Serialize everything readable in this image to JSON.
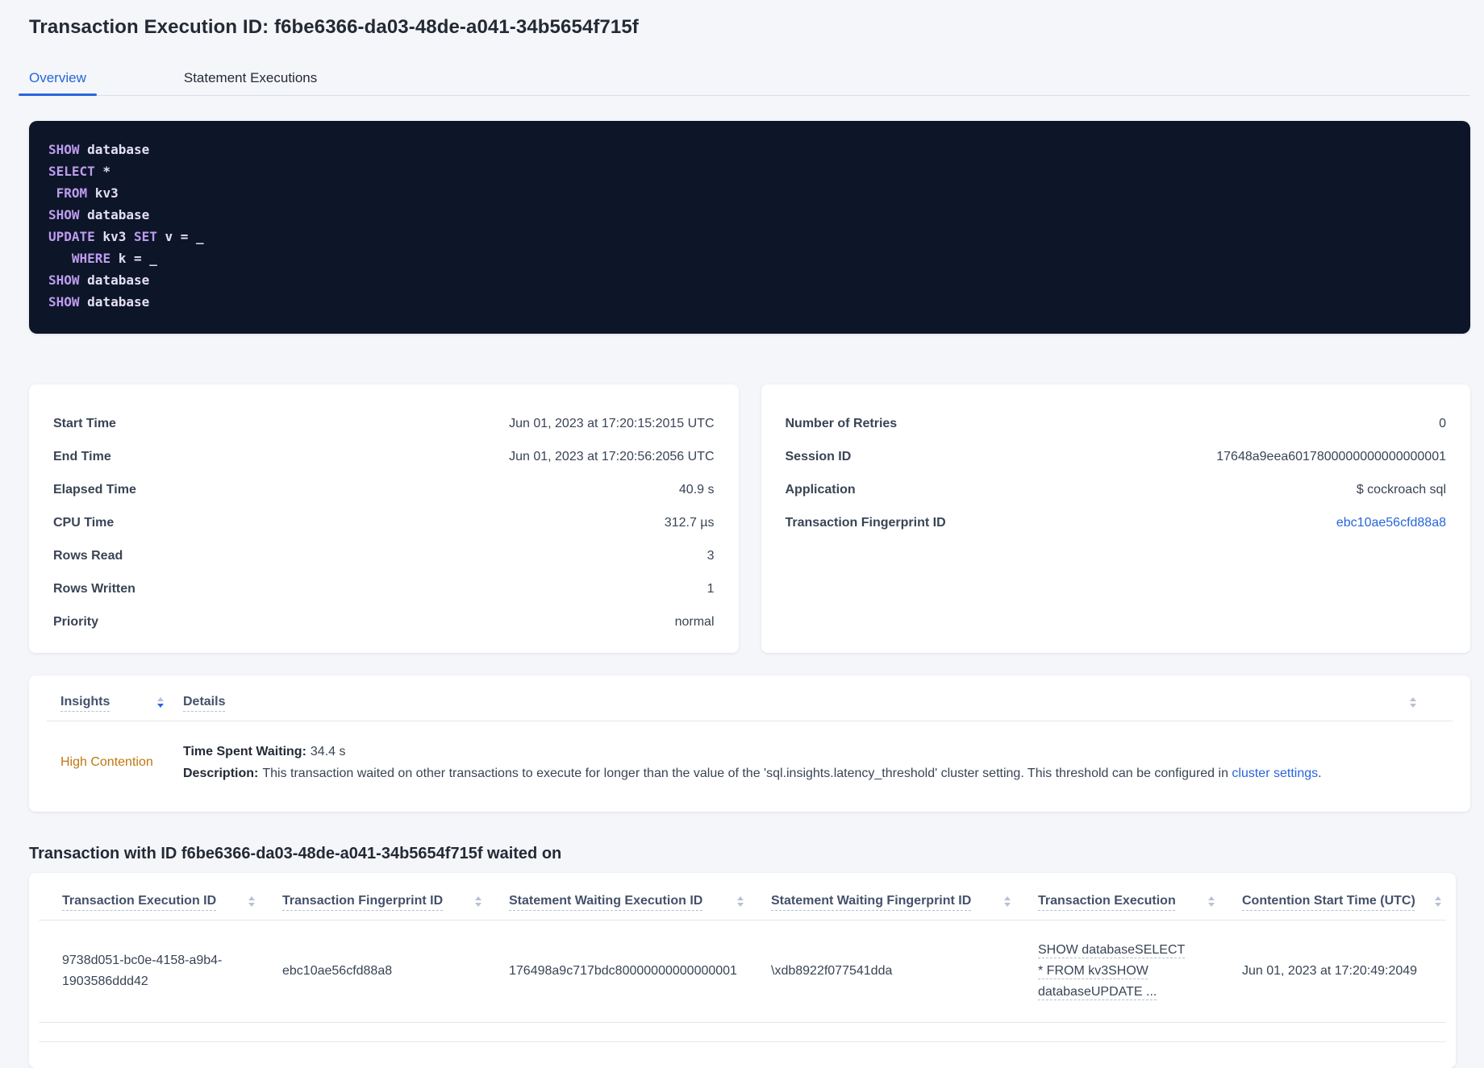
{
  "page": {
    "title": "Transaction Execution ID: f6be6366-da03-48de-a041-34b5654f715f"
  },
  "tabs": [
    {
      "label": "Overview",
      "name": "overview",
      "active": true
    },
    {
      "label": "Statement Executions",
      "name": "statement-executions",
      "active": false
    }
  ],
  "sql": {
    "lines": [
      [
        [
          "k",
          "SHOW"
        ],
        [
          "t",
          " database"
        ]
      ],
      [
        [
          "k",
          "SELECT"
        ],
        [
          "t",
          " *"
        ]
      ],
      [
        [
          "t",
          " "
        ],
        [
          "k",
          "FROM"
        ],
        [
          "t",
          " kv3"
        ]
      ],
      [
        [
          "k",
          "SHOW"
        ],
        [
          "t",
          " database"
        ]
      ],
      [
        [
          "k",
          "UPDATE"
        ],
        [
          "t",
          " kv3 "
        ],
        [
          "k",
          "SET"
        ],
        [
          "t",
          " v = _"
        ]
      ],
      [
        [
          "t",
          "   "
        ],
        [
          "k",
          "WHERE"
        ],
        [
          "t",
          " k = _"
        ]
      ],
      [
        [
          "k",
          "SHOW"
        ],
        [
          "t",
          " database"
        ]
      ],
      [
        [
          "k",
          "SHOW"
        ],
        [
          "t",
          " database"
        ]
      ]
    ]
  },
  "stats_left": {
    "rows": [
      {
        "label": "Start Time",
        "value": "Jun 01, 2023 at 17:20:15:2015 UTC"
      },
      {
        "label": "End Time",
        "value": "Jun 01, 2023 at 17:20:56:2056 UTC"
      },
      {
        "label": "Elapsed Time",
        "value": "40.9 s"
      },
      {
        "label": "CPU Time",
        "value": "312.7 µs"
      },
      {
        "label": "Rows Read",
        "value": "3"
      },
      {
        "label": "Rows Written",
        "value": "1"
      },
      {
        "label": "Priority",
        "value": "normal"
      }
    ]
  },
  "stats_right": {
    "rows": [
      {
        "label": "Number of Retries",
        "value": "0"
      },
      {
        "label": "Session ID",
        "value": "17648a9eea6017800000000000000001"
      },
      {
        "label": "Application",
        "value": "$ cockroach sql"
      },
      {
        "label": "Transaction Fingerprint ID",
        "value": "ebc10ae56cfd88a8",
        "link": true
      }
    ]
  },
  "insights": {
    "col_insights": "Insights",
    "col_details": "Details",
    "row": {
      "insight": "High Contention",
      "waiting_label": "Time Spent Waiting:",
      "waiting_value": "34.4 s",
      "desc_label": "Description:",
      "desc_text": "This transaction waited on other transactions to execute for longer than the value of the 'sql.insights.latency_threshold' cluster setting. This threshold can be configured in ",
      "desc_link": "cluster settings",
      "desc_suffix": "."
    }
  },
  "waited": {
    "heading": "Transaction with ID f6be6366-da03-48de-a041-34b5654f715f waited on",
    "columns": [
      "Transaction Execution ID",
      "Transaction Fingerprint ID",
      "Statement Waiting Execution ID",
      "Statement Waiting Fingerprint ID",
      "Transaction Execution",
      "Contention Start Time (UTC)"
    ],
    "rows": [
      [
        "9738d051-bc0e-4158-a9b4-1903586ddd42",
        "ebc10ae56cfd88a8",
        "176498a9c717bdc80000000000000001",
        "\\xdb8922f077541dda",
        "SHOW databaseSELECT * FROM kv3SHOW databaseUPDATE ...",
        "Jun 01, 2023 at 17:20:49:2049"
      ]
    ]
  },
  "colors": {
    "accent": "#2765dc",
    "warning": "#bf770f",
    "code_bg": "#0d1628",
    "code_kw": "#be9bf0",
    "code_text": "#e4dff2"
  }
}
